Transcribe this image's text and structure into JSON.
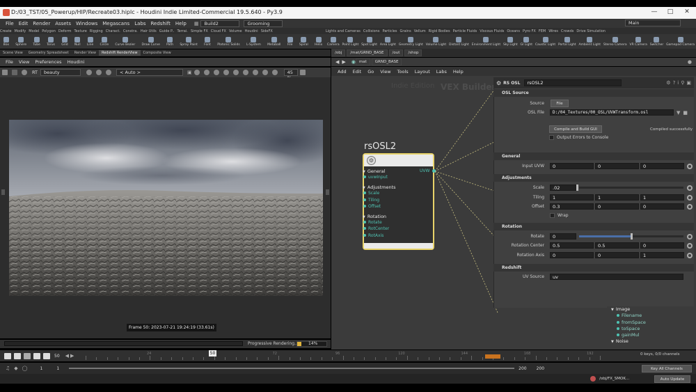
{
  "window": {
    "title": "D:/03_TST/05_Powerup/HIP/Recreate03.hiplc - Houdini Indie Limited-Commercial 19.5.640 - Py3.9"
  },
  "menu": [
    "File",
    "Edit",
    "Render",
    "Assets",
    "Windows",
    "Megascans",
    "Labs",
    "Redshift",
    "Help"
  ],
  "desktop": "Build2",
  "workspace": "Grooming",
  "main_dd": "Main",
  "shelf_tabs_left": [
    "Create",
    "Modify",
    "Model",
    "Polygon",
    "Deform",
    "Texture",
    "Rigging",
    "Charact.",
    "Constra.",
    "Hair Utils",
    "Guide P..",
    "Terrai.",
    "Simple FX",
    "Cloud FX",
    "Volume",
    "Houdini",
    "SideFX"
  ],
  "shelf_tabs_right": [
    "Lights and Cameras",
    "Collisions",
    "Particles",
    "Grains",
    "Vellum",
    "Rigid Bodies",
    "Particle Fluids",
    "Viscous Fluids",
    "Oceans",
    "Pyro FX",
    "FEM",
    "Wires",
    "Crowds",
    "Drive Simulation"
  ],
  "tools_left": [
    "Box",
    "Sphere",
    "Tube",
    "Torus",
    "Grid",
    "Null",
    "Line",
    "Circle",
    "Curve Bezier",
    "Draw Curve",
    "Path",
    "Spray Paint",
    "Font",
    "Platonic Solids",
    "L-System",
    "Metaball",
    "File",
    "Spiral",
    "Helix"
  ],
  "tools_right": [
    "Camera",
    "Point Light",
    "Spot Light",
    "Area Light",
    "Geometry Light",
    "Volume Light",
    "Distant Light",
    "Environment Light",
    "Sky Light",
    "GI Light",
    "Caustic Light",
    "Portal Light",
    "Ambient Light",
    "Stereo Camera",
    "VR Camera",
    "Switcher",
    "Gamepad Camera"
  ],
  "left_tabs": [
    "Scene View",
    "Geometry Spreadsheet",
    "Render View",
    "Redshift RenderView",
    "Composite View"
  ],
  "left_menu": [
    "File",
    "View",
    "Preferences",
    "Houdini"
  ],
  "viewport": {
    "aov": "beauty",
    "rt": "RT",
    "camera": "< Auto >",
    "zoom": "45 %",
    "frame_label": "Frame 50: 2023-07-21 19:24:19 (33.61s)",
    "progress_label": "Progressive Rendering...",
    "progress_value": "14%",
    "progress_fraction": 0.14
  },
  "network": {
    "path_tabs": [
      "/obj",
      "/mat/GRND_BASE",
      "/out",
      "/shop"
    ],
    "path_obj": "mat",
    "path_node": "GRND_BASE",
    "menu": [
      "Add",
      "Edit",
      "Go",
      "View",
      "Tools",
      "Layout",
      "Labs",
      "Help"
    ],
    "watermark1": "Indie Edition",
    "watermark2": "VEX Builder"
  },
  "node": {
    "name": "rsOSL2",
    "output": "UVW",
    "general": "General",
    "general_in": [
      "uvwInput"
    ],
    "adjustments": "Adjustments",
    "adj_in": [
      "Scale",
      "Tiling",
      "Offset"
    ],
    "rotation": "Rotation",
    "rot_in": [
      "Rotate",
      "RotCenter",
      "RotAxis"
    ]
  },
  "params": {
    "type": "RS OSL",
    "name": "rsOSL2",
    "osl_section": "OSL Source",
    "source_label": "Source",
    "source_value": "File",
    "osl_file_label": "OSL File",
    "osl_file_value": "D:/04_Textures/00_OSL/UVWTransform.osl",
    "compile_btn": "Compile and Build GUI",
    "compiled_msg": "Compiled successfully",
    "errors_label": "Output Errors to Console",
    "general_section": "General",
    "input_uvw_label": "Input UVW",
    "input_uvw": [
      "0",
      "0",
      "0"
    ],
    "adj_section": "Adjustments",
    "scale_label": "Scale",
    "scale_value": ".02",
    "tiling_label": "Tiling",
    "tiling": [
      "1",
      "1",
      "1"
    ],
    "offset_label": "Offset",
    "offset": [
      "0.3",
      "0",
      "0"
    ],
    "wrap_label": "Wrap",
    "rot_section": "Rotation",
    "rotate_label": "Rotate",
    "rotate_value": "0",
    "rotcenter_label": "Rotation Center",
    "rotcenter": [
      "0.5",
      "0.5",
      "0"
    ],
    "rotaxis_label": "Rotation Axis",
    "rotaxis": [
      "0",
      "0",
      "1"
    ],
    "rs_section": "Redshift",
    "uvsrc_label": "UV Source",
    "uvsrc_value": "uv"
  },
  "sublist": {
    "image": "Image",
    "items": [
      "Filename",
      "fromSpace",
      "toSpace",
      "gainMul"
    ],
    "noise": "Noise"
  },
  "timeline": {
    "frame": "50",
    "ticks": [
      "24",
      "48",
      "72",
      "96",
      "120",
      "144",
      "168",
      "192"
    ],
    "current": "50",
    "start": "1",
    "start2": "1",
    "end": "200",
    "end2": "200",
    "keys": "0 keys, 0/0 channels",
    "key_all": "Key All Channels",
    "auto_update": "Auto Update",
    "status_path": "/obj/FX_SMOK..."
  }
}
